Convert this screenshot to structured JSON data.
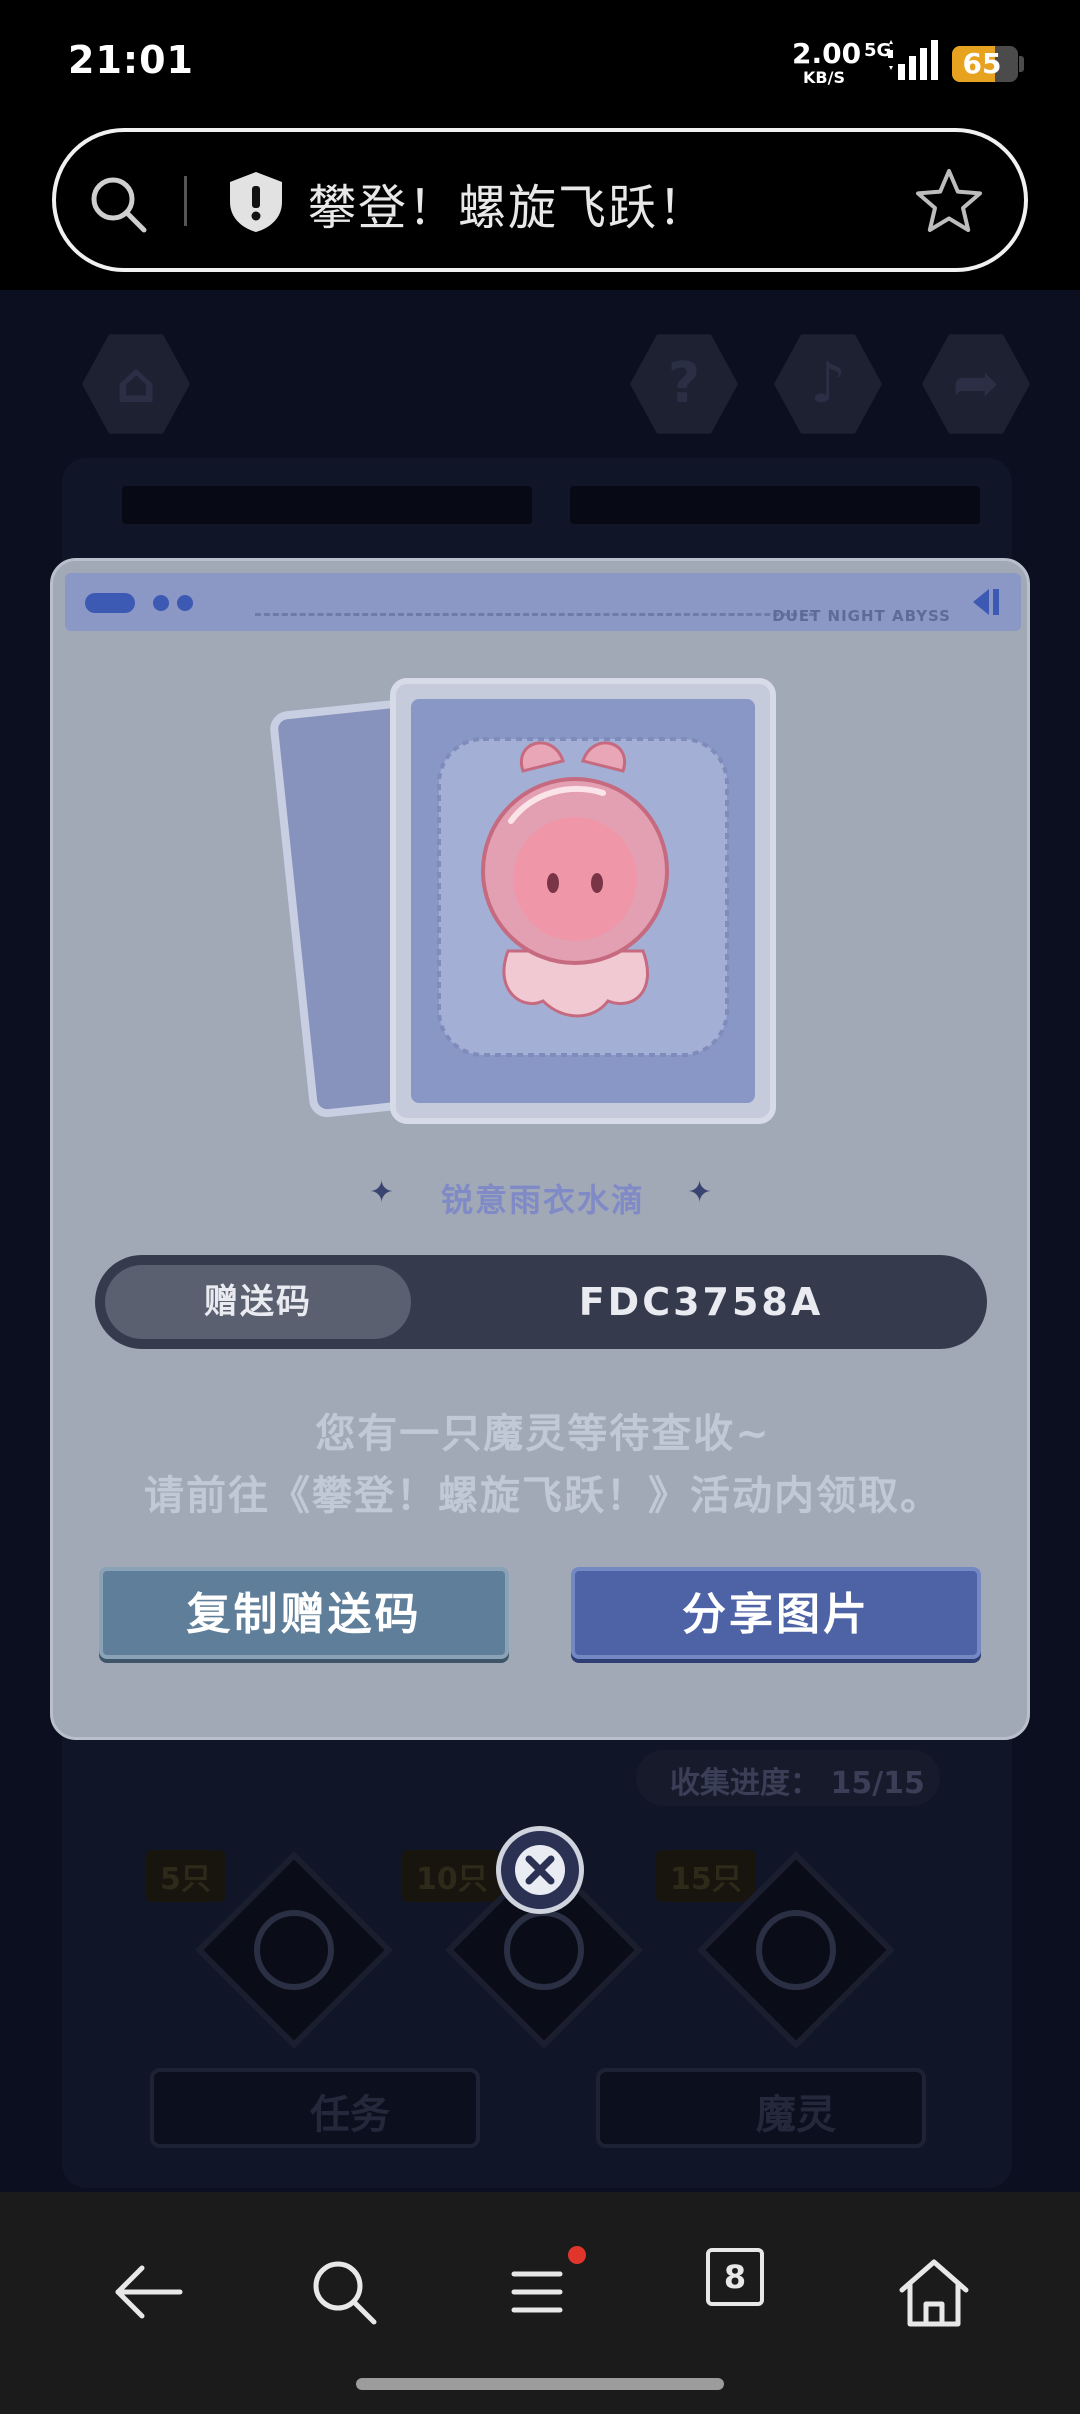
{
  "status_bar": {
    "time": "21:01",
    "net_speed": "2.00",
    "net_speed_unit": "KB/S",
    "network_type": "5G",
    "battery_level": "65"
  },
  "browser": {
    "page_title": "攀登！螺旋飞跃！"
  },
  "game_background": {
    "collection_progress": "收集进度： 15/15",
    "tiers": [
      "5只",
      "10只",
      "15只"
    ],
    "tabs": [
      "任务",
      "魔灵"
    ]
  },
  "modal": {
    "brand_text": "DUET NIGHT ABYSS",
    "pet_name": "锐意雨衣水滴",
    "code_label": "赠送码",
    "code_value": "FDC3758A",
    "message_line1": "您有一只魔灵等待查收~",
    "message_line2": "请前往《攀登！螺旋飞跃！》活动内领取。",
    "copy_button": "复制赠送码",
    "share_button": "分享图片"
  },
  "bottom_nav": {
    "tab_count": "8"
  },
  "colors": {
    "modal_bg": "#a1a8b6",
    "code_bar": "#353b4d",
    "copy_button": "#5f7e9a",
    "share_button": "#4e63a6",
    "battery": "#e7a320",
    "notification_dot": "#e0352b"
  },
  "icons": [
    "search-icon",
    "shield-icon",
    "star-icon",
    "home-icon",
    "help-icon",
    "music-icon",
    "share-icon",
    "close-icon",
    "back-icon",
    "menu-icon",
    "tabs-icon"
  ]
}
